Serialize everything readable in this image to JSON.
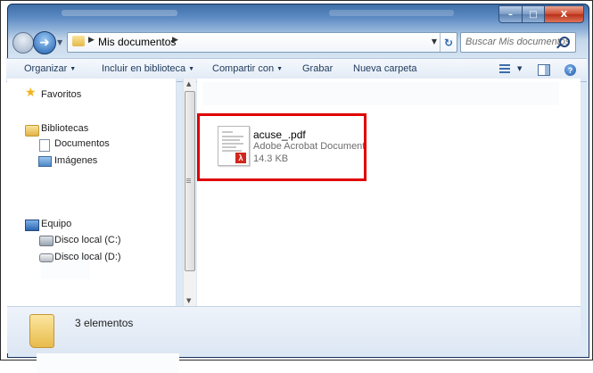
{
  "address": {
    "path": "Mis documentos"
  },
  "search": {
    "placeholder": "Buscar Mis documentos"
  },
  "toolbar": {
    "organize": "Organizar",
    "include_library": "Incluir en biblioteca",
    "share_with": "Compartir con",
    "burn": "Grabar",
    "new_folder": "Nueva carpeta"
  },
  "navigation": {
    "favorites": "Favoritos",
    "libraries": "Bibliotecas",
    "library_items": [
      "Documentos",
      "Imágenes"
    ],
    "computer": "Equipo",
    "drives": [
      "Disco local (C:)",
      "Disco local (D:)"
    ]
  },
  "file": {
    "name": "acuse_.pdf",
    "type": "Adobe Acrobat Document",
    "size": "14.3 KB"
  },
  "details": {
    "count": "3 elementos"
  },
  "colors": {
    "highlight": "#e00000",
    "accent": "#1e395b"
  },
  "icons": [
    "folder-icon",
    "star-icon",
    "library-icon",
    "document-icon",
    "images-icon",
    "computer-icon",
    "drive-icon",
    "pdf-icon",
    "search-icon",
    "help-icon"
  ]
}
